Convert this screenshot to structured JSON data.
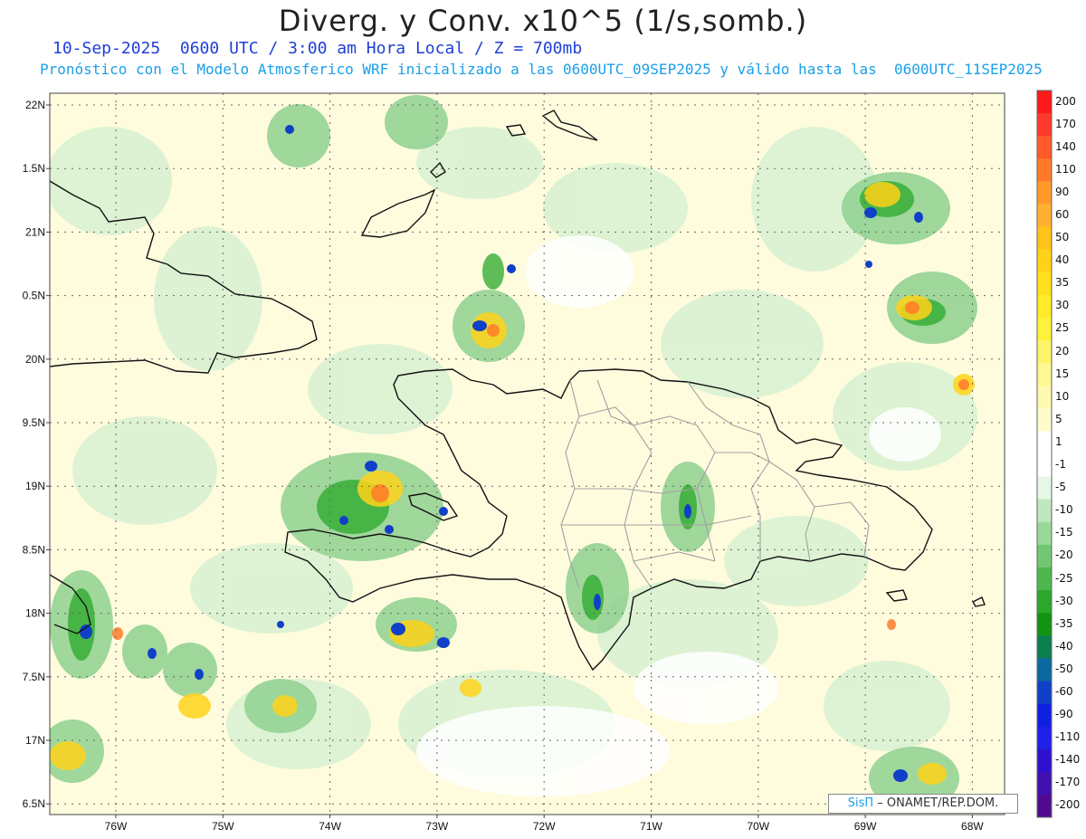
{
  "title": "Diverg. y Conv. x10^5 (1/s,somb.)",
  "subtitle_line1": "10-Sep-2025  0600 UTC / 3:00 am Hora Local / Z = 700mb",
  "subtitle_line2": "Pronóstico con el Modelo Atmosferico WRF inicializado a las 0600UTC_09SEP2025 y válido hasta las  0600UTC_11SEP2025",
  "credit": {
    "brand": "SisΠ",
    "text": "– ONAMET/REP.DOM."
  },
  "lat_labels": [
    "22N",
    "1.5N",
    "21N",
    "0.5N",
    "20N",
    "9.5N",
    "19N",
    "8.5N",
    "18N",
    "7.5N",
    "17N",
    "6.5N"
  ],
  "lon_labels": [
    "76W",
    "75W",
    "74W",
    "73W",
    "72W",
    "71W",
    "70W",
    "69W",
    "68W"
  ],
  "colorbar": {
    "labels": [
      "200",
      "170",
      "140",
      "110",
      "90",
      "60",
      "50",
      "40",
      "35",
      "30",
      "25",
      "20",
      "15",
      "10",
      "5",
      "1",
      "-1",
      "-5",
      "-10",
      "-15",
      "-20",
      "-25",
      "-30",
      "-35",
      "-40",
      "-50",
      "-60",
      "-90",
      "-110",
      "-140",
      "-170",
      "-200"
    ],
    "colors": [
      "#ff1a1a",
      "#ff3a2a",
      "#ff5a2a",
      "#ff7a2a",
      "#ff9a2a",
      "#ffb030",
      "#ffc41a",
      "#ffd21a",
      "#ffe01a",
      "#ffeb2a",
      "#fff23a",
      "#fff56a",
      "#fff890",
      "#fffab0",
      "#fffccc",
      "#ffffff",
      "#ffffff",
      "#e6f7e6",
      "#bfe8bf",
      "#9ad89a",
      "#72c872",
      "#4db84d",
      "#2aa82a",
      "#119511",
      "#0a8050",
      "#0a6aa0",
      "#1040c8",
      "#1020e0",
      "#2020e8",
      "#3010d0",
      "#4010b0",
      "#500a90"
    ]
  }
}
